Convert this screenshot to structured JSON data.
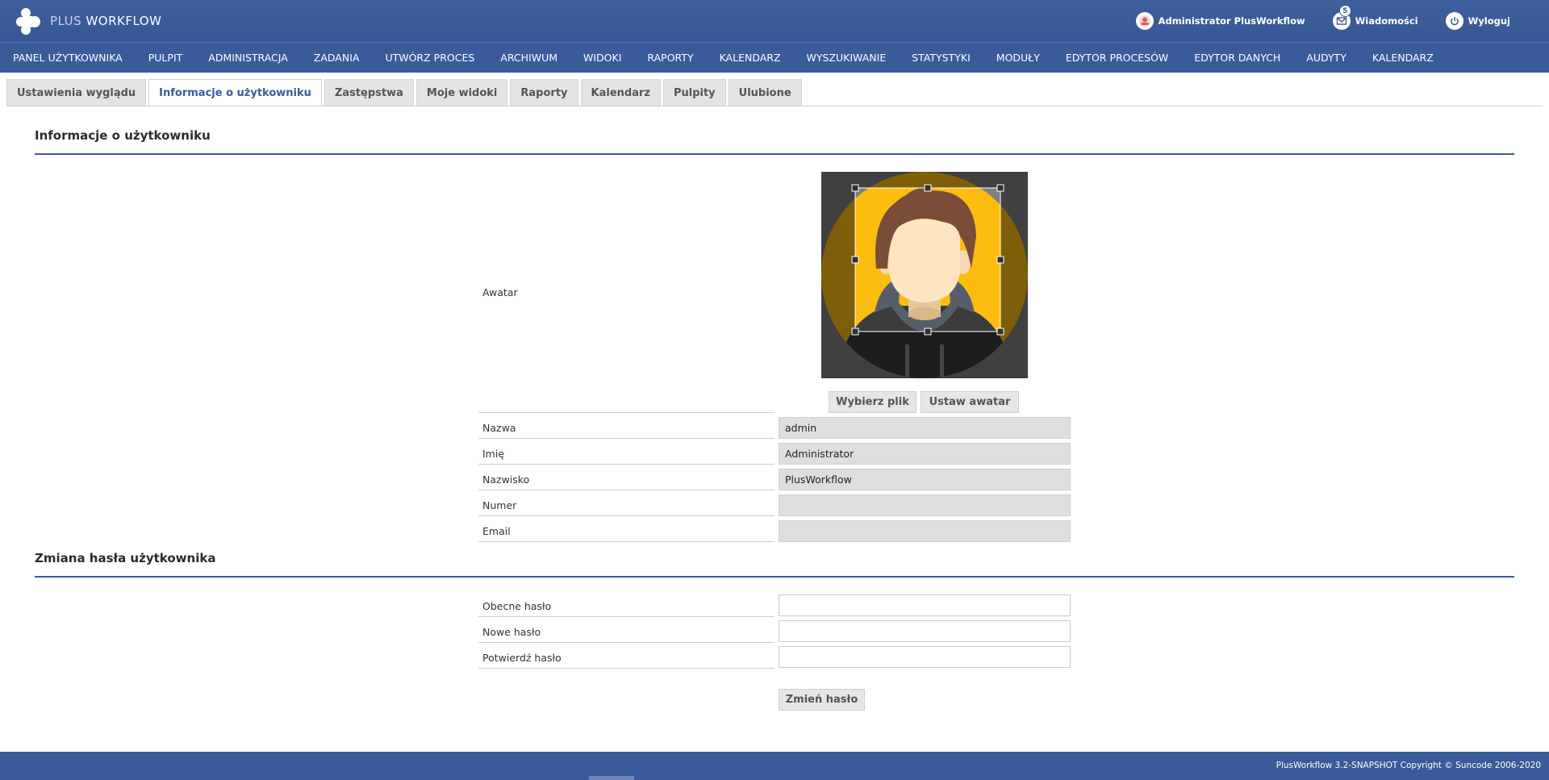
{
  "app": {
    "logo_plus": "PLUS",
    "logo_workflow": "WORKFLOW"
  },
  "header": {
    "user_label": "Administrator PlusWorkflow",
    "messages_label": "Wiadomości",
    "messages_count": "5",
    "logout_label": "Wyloguj"
  },
  "nav": {
    "items": [
      "PANEL UŻYTKOWNIKA",
      "PULPIT",
      "ADMINISTRACJA",
      "ZADANIA",
      "UTWÓRZ PROCES",
      "ARCHIWUM",
      "WIDOKI",
      "RAPORTY",
      "KALENDARZ",
      "WYSZUKIWANIE",
      "STATYSTYKI",
      "MODUŁY",
      "EDYTOR PROCESÓW",
      "EDYTOR DANYCH",
      "AUDYTY",
      "KALENDARZ"
    ]
  },
  "tabs": [
    "Ustawienia wyglądu",
    "Informacje o użytkowniku",
    "Zastępstwa",
    "Moje widoki",
    "Raporty",
    "Kalendarz",
    "Pulpity",
    "Ulubione"
  ],
  "active_tab": "Informacje o użytkowniku",
  "user_info": {
    "title": "Informacje o użytkowniku",
    "avatar_label": "Awatar",
    "choose_file_label": "Wybierz plik",
    "set_avatar_label": "Ustaw awatar",
    "fields": [
      {
        "label": "Nazwa",
        "value": "admin"
      },
      {
        "label": "Imię",
        "value": "Administrator"
      },
      {
        "label": "Nazwisko",
        "value": "PlusWorkflow"
      },
      {
        "label": "Numer",
        "value": ""
      },
      {
        "label": "Email",
        "value": ""
      }
    ]
  },
  "password": {
    "title": "Zmiana hasła użytkownika",
    "current_label": "Obecne hasło",
    "new_label": "Nowe hasło",
    "confirm_label": "Potwierdź hasło",
    "submit_label": "Zmień hasło"
  },
  "footer": {
    "text": "PlusWorkflow 3.2-SNAPSHOT Copyright © Suncode 2006-2020"
  },
  "colors": {
    "brand": "#3a5a9a",
    "field_bg": "#dedede"
  }
}
